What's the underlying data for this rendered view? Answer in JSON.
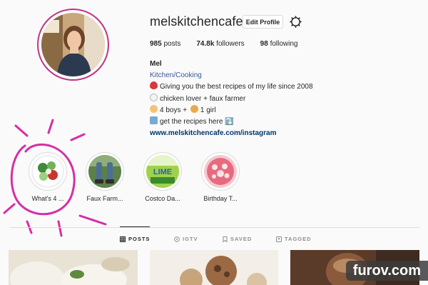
{
  "profile": {
    "username": "melskitchencafe",
    "edit_label": "Edit Profile",
    "stats": [
      {
        "value": "985",
        "label": "posts"
      },
      {
        "value": "74.8k",
        "label": "followers"
      },
      {
        "value": "98",
        "label": "following"
      }
    ],
    "name": "Mel",
    "category": "Kitchen/Cooking",
    "bio_lines": [
      {
        "emoji": "strawberry-icon",
        "text": "Giving you the best recipes of my life since 2008"
      },
      {
        "emoji": "chicken-icon",
        "text": "chicken lover + faux farmer"
      },
      {
        "emoji": "boy-icon",
        "text": "4 boys + "
      },
      {
        "emoji": "book-icon",
        "text": "get the recipes here ⤵️"
      }
    ],
    "bio_girl_text": "1 girl",
    "link": "www.melskitchencafe.com/instagram"
  },
  "highlights": [
    {
      "label": "What's 4 ..."
    },
    {
      "label": "Faux Farm..."
    },
    {
      "label": "Costco Da..."
    },
    {
      "label": "Birthday T..."
    }
  ],
  "highlight_art": {
    "costco_word": "LIME"
  },
  "tabs": [
    {
      "label": "POSTS"
    },
    {
      "label": "IGTV"
    },
    {
      "label": "SAVED"
    },
    {
      "label": "TAGGED"
    }
  ],
  "watermark": "furov.com",
  "colors": {
    "link": "#003569",
    "category": "#385898",
    "ring": "#c13584",
    "annotation": "#d62ea8"
  }
}
